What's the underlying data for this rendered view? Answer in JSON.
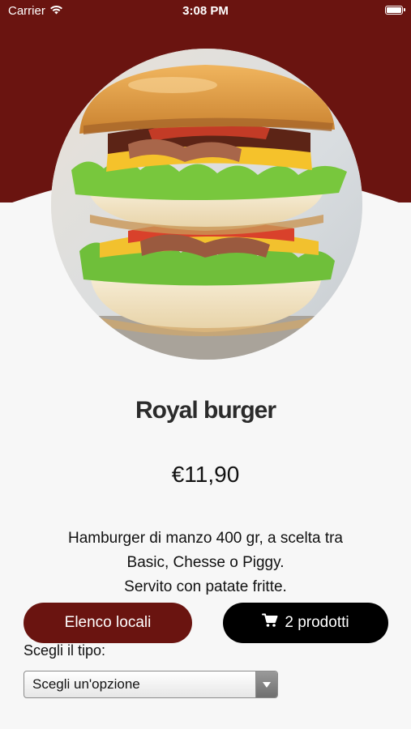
{
  "status_bar": {
    "carrier": "Carrier",
    "time": "3:08 PM",
    "icons": [
      "wifi-icon",
      "battery-icon"
    ]
  },
  "colors": {
    "brand": "#6a1410",
    "cart_button": "#000000",
    "background": "#f7f7f7"
  },
  "product": {
    "name": "Royal burger",
    "price": "€11,90",
    "description": [
      "Hamburger di manzo 400 gr, a scelta tra",
      "Basic, Chesse o Piggy.",
      "Servito con patate fritte."
    ]
  },
  "actions": {
    "locali_label": "Elenco locali",
    "cart_label": "2 prodotti",
    "cart_icon": "cart-icon"
  },
  "type_select": {
    "label": "Scegli il tipo:",
    "value": "Scegli un'opzione"
  }
}
